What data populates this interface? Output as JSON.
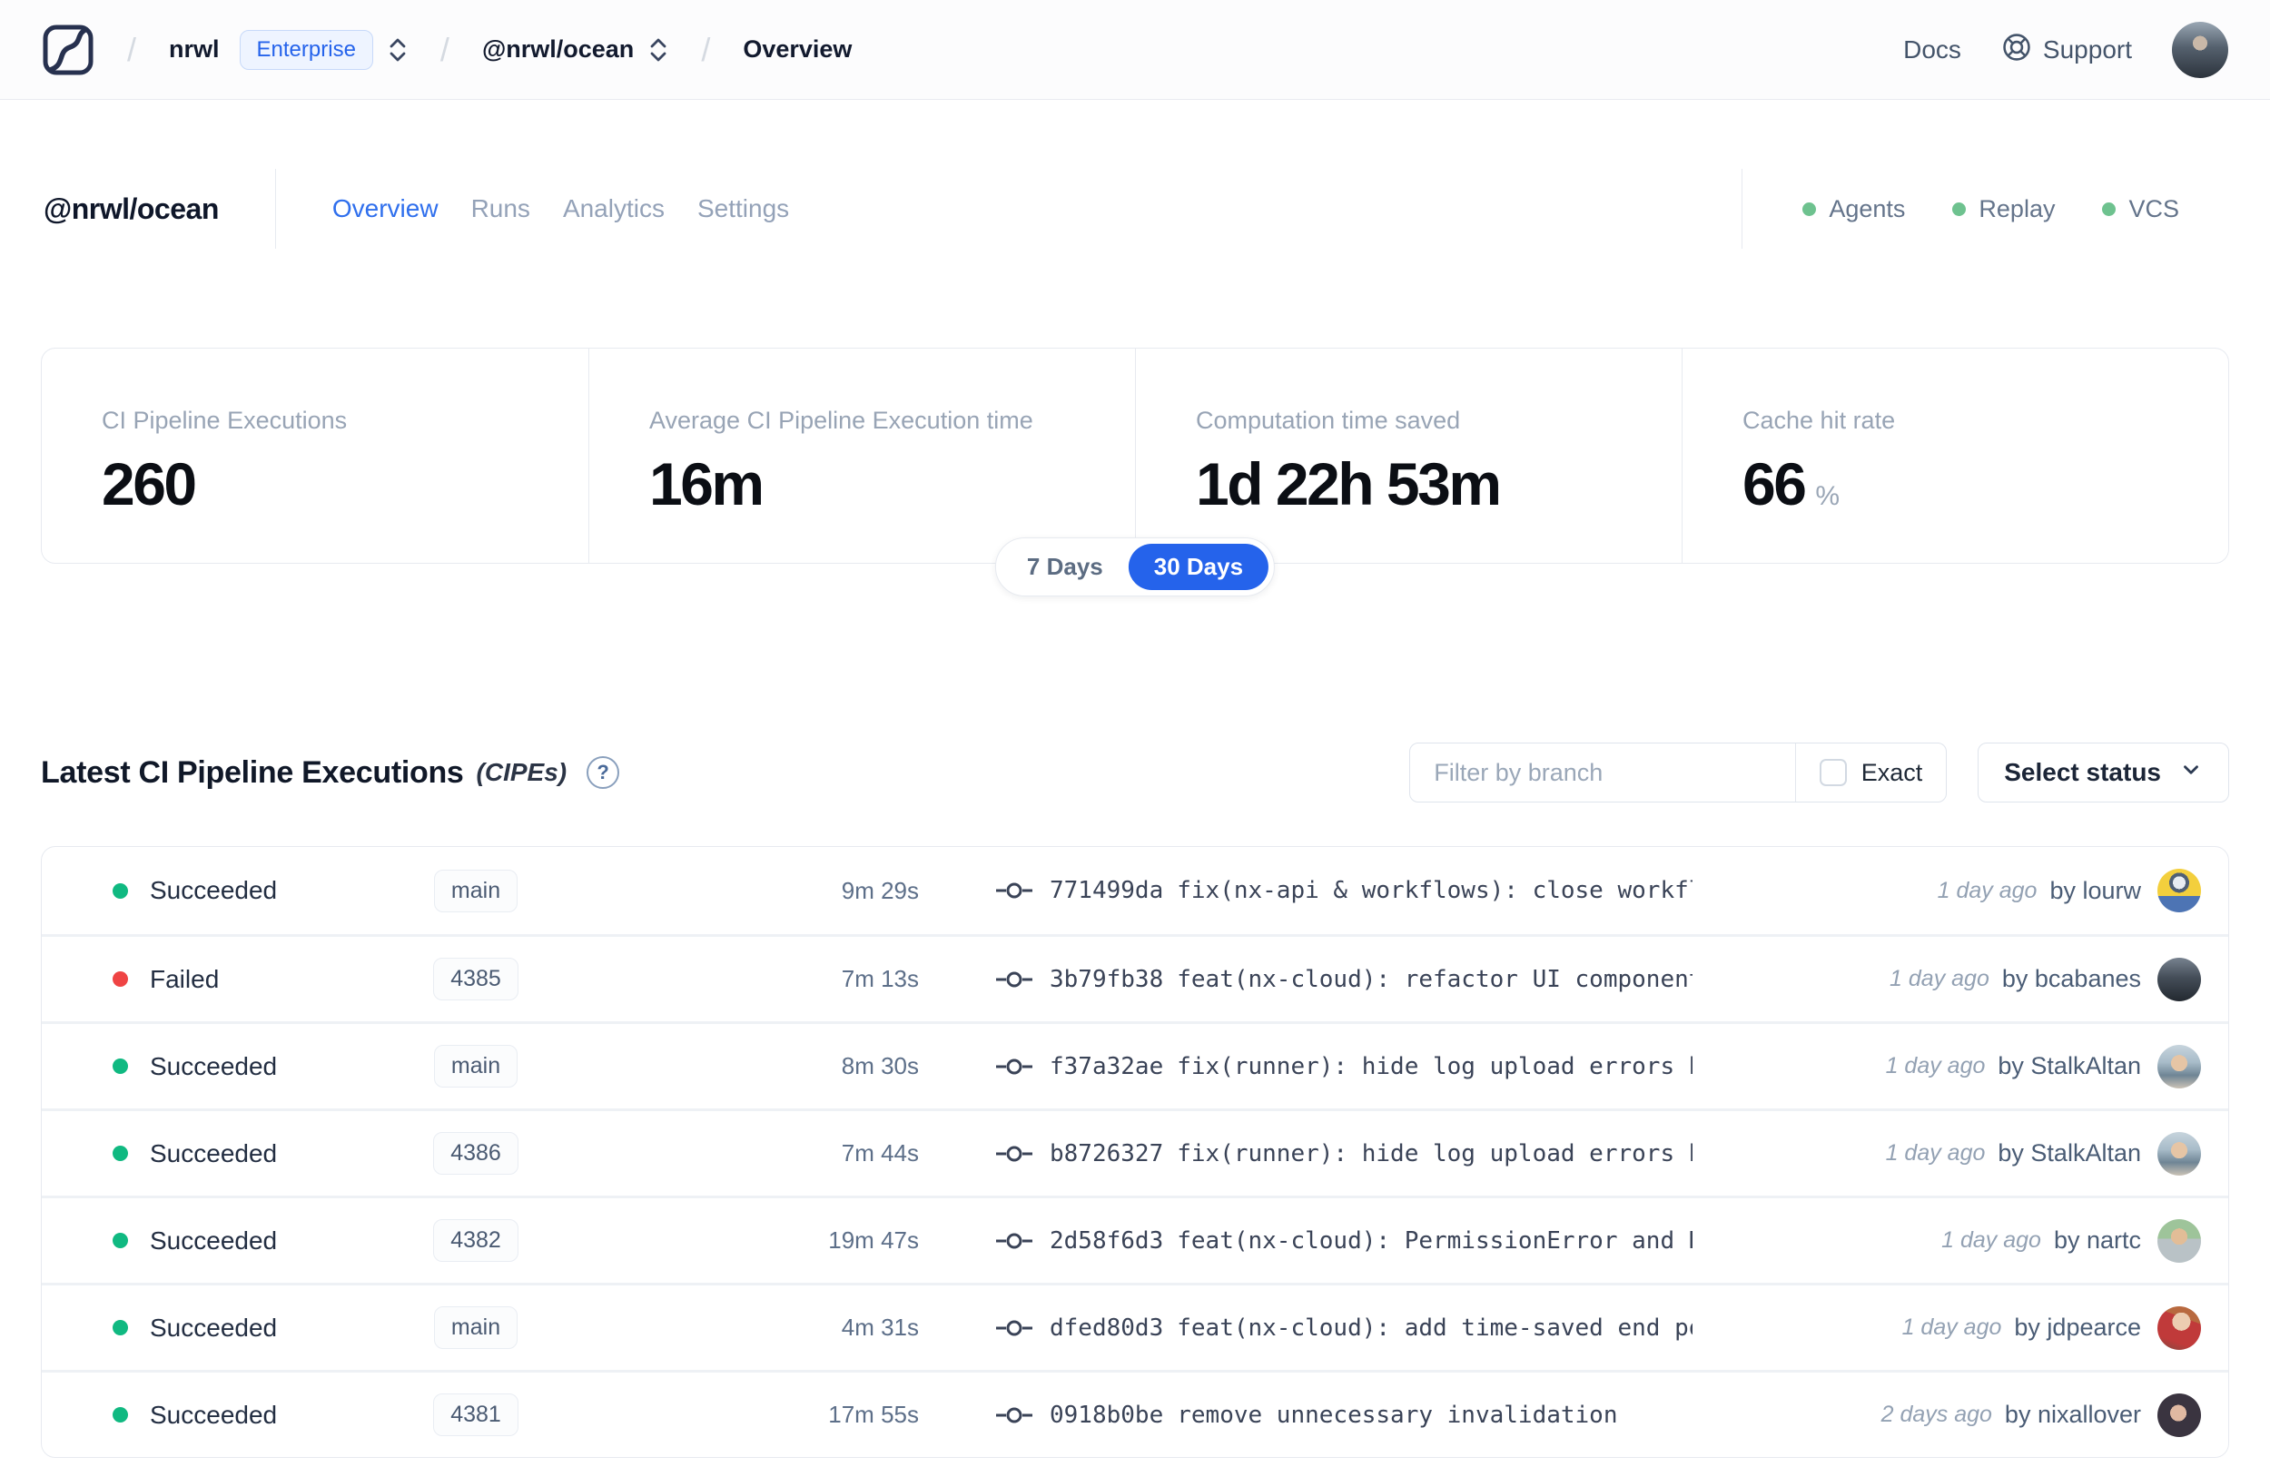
{
  "topbar": {
    "separator": "/",
    "org": "nrwl",
    "org_badge": "Enterprise",
    "workspace": "@nrwl/ocean",
    "page": "Overview",
    "docs_label": "Docs",
    "support_label": "Support"
  },
  "user": {
    "avatar": "radial-gradient(circle at 50% 38%, #c9b8a8 0 8px, rgba(0,0,0,0) 8px), linear-gradient(180deg, #9aa7b4 0%, #55616e 45%, #2c333c 100%)"
  },
  "workspace_header": {
    "title": "@nrwl/ocean",
    "tabs": [
      {
        "label": "Overview",
        "active": true
      },
      {
        "label": "Runs",
        "active": false
      },
      {
        "label": "Analytics",
        "active": false
      },
      {
        "label": "Settings",
        "active": false
      }
    ],
    "statuses": [
      {
        "label": "Agents"
      },
      {
        "label": "Replay"
      },
      {
        "label": "VCS"
      }
    ],
    "status_dot_color": "#6ec28f"
  },
  "stats": {
    "cards": [
      {
        "label": "CI Pipeline Executions",
        "value": "260",
        "suffix": ""
      },
      {
        "label": "Average CI Pipeline Execution time",
        "value": "16m",
        "suffix": ""
      },
      {
        "label": "Computation time saved",
        "value": "1d 22h 53m",
        "suffix": ""
      },
      {
        "label": "Cache hit rate",
        "value": "66",
        "suffix": "%"
      }
    ]
  },
  "time_toggle": {
    "options": [
      {
        "label": "7 Days",
        "active": false
      },
      {
        "label": "30 Days",
        "active": true
      }
    ],
    "active_color": "#2563eb"
  },
  "cipe_section": {
    "title": "Latest CI Pipeline Executions",
    "title_suffix": "(CIPEs)",
    "help_glyph": "?",
    "filter_placeholder": "Filter by branch",
    "exact_label": "Exact",
    "status_select_label": "Select status"
  },
  "cipe_table": {
    "status_colors": {
      "Succeeded": "#10b981",
      "Failed": "#ef4444"
    },
    "rows": [
      {
        "status": "Succeeded",
        "branch": "main",
        "duration": "9m 29s",
        "commit_hash": "771499da",
        "commit_message": "fix(nx-api & workflows): close workfl…",
        "time_ago": "1 day ago",
        "author": "by lourw",
        "avatar": "radial-gradient(circle at 50% 32%, #e8edf2 0 7px, #4f6076 7px 11px, rgba(0,0,0,0) 11px), linear-gradient(180deg, #f3cf3d 0 62%, #4d74b4 62% 100%)"
      },
      {
        "status": "Failed",
        "branch": "4385",
        "duration": "7m 13s",
        "commit_hash": "3b79fb38",
        "commit_message": "feat(nx-cloud): refactor UI component…",
        "time_ago": "1 day ago",
        "author": "by bcabanes",
        "avatar": "linear-gradient(180deg, #77828f 0%, #454e59 45%, #232930 100%)"
      },
      {
        "status": "Succeeded",
        "branch": "main",
        "duration": "8m 30s",
        "commit_hash": "f37a32ae",
        "commit_message": "fix(runner): hide log upload errors b…",
        "time_ago": "1 day ago",
        "author": "by StalkAltan",
        "avatar": "radial-gradient(circle at 50% 42%, #e6c5a5 0 9px, rgba(0,0,0,0) 9px), linear-gradient(180deg, #c7d4dd 0%, #a8bcc9 40%, #6f8595 70%, #cbc2b6 100%)"
      },
      {
        "status": "Succeeded",
        "branch": "4386",
        "duration": "7m 44s",
        "commit_hash": "b8726327",
        "commit_message": "fix(runner): hide log upload errors b…",
        "time_ago": "1 day ago",
        "author": "by StalkAltan",
        "avatar": "radial-gradient(circle at 50% 42%, #e6c5a5 0 9px, rgba(0,0,0,0) 9px), linear-gradient(180deg, #c7d4dd 0%, #a8bcc9 40%, #6f8595 70%, #cbc2b6 100%)"
      },
      {
        "status": "Succeeded",
        "branch": "4382",
        "duration": "19m 47s",
        "commit_hash": "2d58f6d3",
        "commit_message": "feat(nx-cloud): PermissionError and N…",
        "time_ago": "1 day ago",
        "author": "by nartc",
        "avatar": "radial-gradient(circle at 50% 40%, #e2bd97 0 9px, rgba(0,0,0,0) 9px), linear-gradient(180deg, #9ec49a 0 45%, #b9c2c6 45% 100%)"
      },
      {
        "status": "Succeeded",
        "branch": "main",
        "duration": "4m 31s",
        "commit_hash": "dfed80d3",
        "commit_message": "feat(nx-cloud): add time-saved end po…",
        "time_ago": "1 day ago",
        "author": "by jdpearce",
        "avatar": "radial-gradient(circle at 55% 35%, #eccdb1 0 10px, rgba(0,0,0,0) 10px), linear-gradient(200deg, #b8693f 0 30%, #c03a3a 30% 75%, #7c4b41 100%)"
      },
      {
        "status": "Succeeded",
        "branch": "4381",
        "duration": "17m 55s",
        "commit_hash": "0918b0be",
        "commit_message": "remove unnecessary invalidation",
        "time_ago": "2 days ago",
        "author": "by nixallover",
        "avatar": "radial-gradient(circle at 48% 45%, #e0b9a2 0 9px, rgba(0,0,0,0) 9px), linear-gradient(180deg, #3a3440 0 100%)"
      }
    ]
  }
}
